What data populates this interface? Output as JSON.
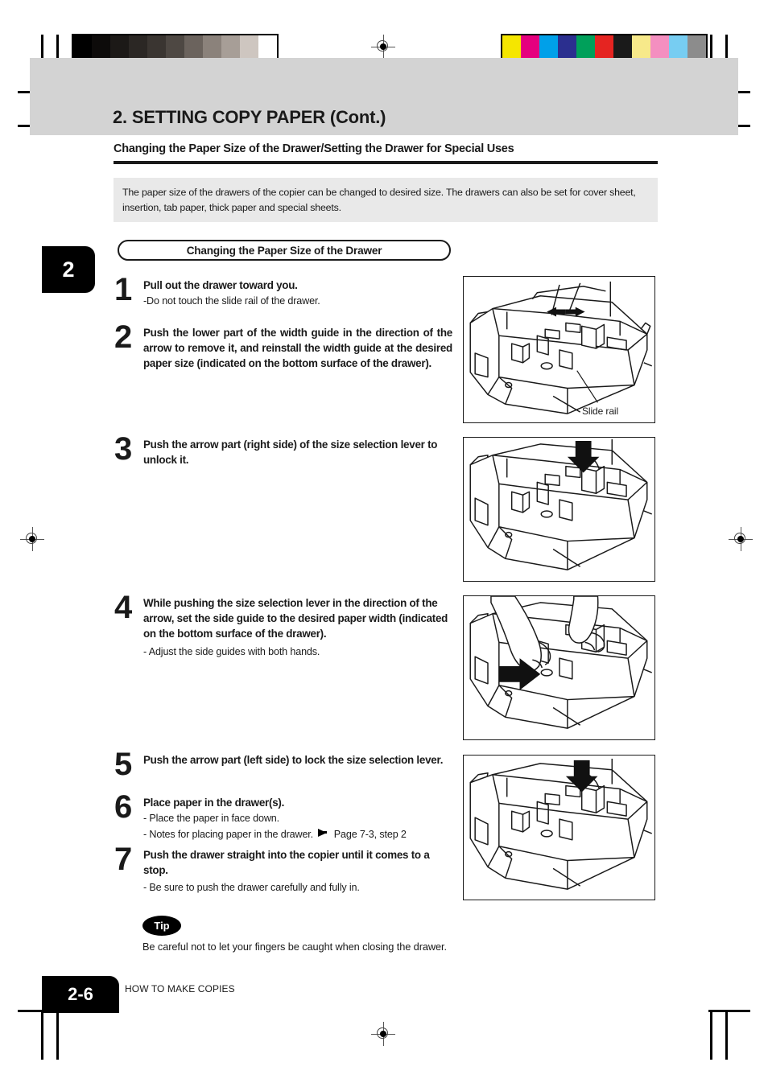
{
  "header": {
    "title": "2. SETTING COPY PAPER (Cont.)",
    "subheading": "Changing the Paper Size of the Drawer/Setting the Drawer for Special Uses",
    "chapter_tab": "2"
  },
  "intro": {
    "text": "The paper size of the drawers of the copier can be changed to desired size. The drawers can also be set for cover sheet, insertion, tab paper, thick paper and special sheets."
  },
  "section": {
    "pill_label": "Changing the Paper Size of the Drawer"
  },
  "steps": [
    {
      "number": "1",
      "title": "Pull out the drawer toward you.",
      "notes": [
        "-Do not touch the slide rail of the drawer."
      ]
    },
    {
      "number": "2",
      "title": "Push the lower part of the width guide in the direction of the arrow to remove it, and reinstall the width guide at the desired paper size (indicated on the bottom surface of the drawer).",
      "notes": []
    },
    {
      "number": "3",
      "title": "Push the arrow part (right side) of the size selection lever to unlock it.",
      "notes": []
    },
    {
      "number": "4",
      "title": "While pushing the size selection lever in the direction of the arrow, set the side guide to the desired paper width (indicated on the bottom surface of the drawer).",
      "notes": [
        "- Adjust the side guides with both hands."
      ]
    },
    {
      "number": "5",
      "title": "Push the arrow part (left side) to lock the size selection lever.",
      "notes": []
    },
    {
      "number": "6",
      "title": "Place paper in the drawer(s).",
      "notes": [
        "- Place  the paper in face down."
      ],
      "reference_note_prefix": "- Notes for placing paper in the drawer.",
      "reference_note_target": "Page 7-3, step 2"
    },
    {
      "number": "7",
      "title": "Push the drawer straight into the copier until it comes to a stop.",
      "notes": [
        "- Be sure to push the drawer carefully and fully in."
      ]
    }
  ],
  "figures": [
    {
      "caption": "Slide rail",
      "alt": "Paper drawer pulled out with two arrows pointing at the width guide"
    },
    {
      "caption": "",
      "alt": "Paper drawer with a down arrow at the size selection lever right side"
    },
    {
      "caption": "",
      "alt": "Hands adjusting the side guide with a right pointing arrow"
    },
    {
      "caption": "",
      "alt": "Paper drawer with a down arrow at the size selection lever left side"
    }
  ],
  "tip": {
    "badge": "Tip",
    "text": "Be careful not to let your fingers be caught when closing the drawer."
  },
  "footer": {
    "page_number": "2-6",
    "section_name": "HOW TO MAKE COPIES"
  },
  "prepress": {
    "grayscale_patches": [
      "#000000",
      "#0d0b0a",
      "#1c1917",
      "#2b2724",
      "#3a3531",
      "#4e4843",
      "#6b635d",
      "#8b827b",
      "#a79e97",
      "#cec6c0",
      "#ffffff"
    ],
    "color_patches": [
      "#f5e600",
      "#e5007e",
      "#00a0e9",
      "#2b2f8f",
      "#00a05a",
      "#e52421",
      "#1a1a1a",
      "#f7e98a",
      "#f48fc0",
      "#77cdf2",
      "#8c8c8c"
    ]
  }
}
